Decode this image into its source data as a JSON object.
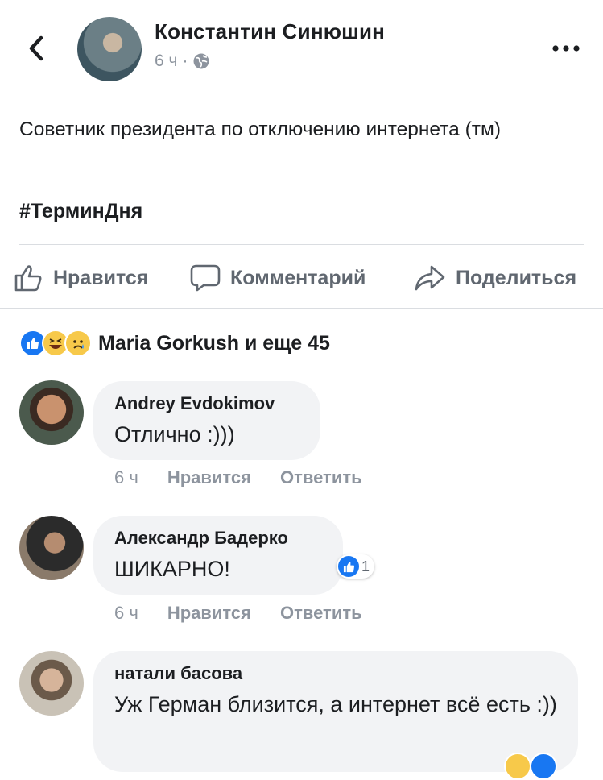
{
  "post": {
    "author": "Константин Синюшин",
    "time": "6 ч",
    "separator": "·",
    "text": "Советник президента по отключению интернета (тм)",
    "hashtag": "#ТерминДня"
  },
  "actions": {
    "like": "Нравится",
    "comment": "Комментарий",
    "share": "Поделиться"
  },
  "reactions": {
    "summary": "Maria Gorkush и еще 45",
    "icons": [
      "like-icon",
      "laugh-emoji-icon",
      "sad-emoji-icon"
    ]
  },
  "comments": [
    {
      "name": "Andrey Evdokimov",
      "text": "Отлично :)))",
      "time": "6 ч",
      "like": "Нравится",
      "reply": "Ответить"
    },
    {
      "name": "Александр Бадерко",
      "text": "ШИКАРНО!",
      "time": "6 ч",
      "like": "Нравится",
      "reply": "Ответить",
      "likes": "1"
    },
    {
      "name": "натали басова",
      "text": "Уж Герман близится, а интернет всё есть :))"
    }
  ],
  "colors": {
    "brand_blue": "#1877f2",
    "text": "#1c1e21",
    "muted": "#8d949e",
    "action_grey": "#606770",
    "bubble": "#f2f3f5"
  }
}
